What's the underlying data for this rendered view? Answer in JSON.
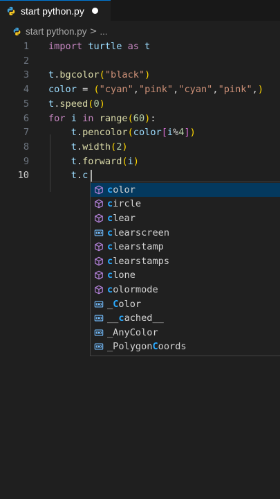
{
  "tab": {
    "label": "start python.py",
    "icon": "python-icon",
    "dirty_indicator": "modified-dot"
  },
  "breadcrumb": {
    "file": "start python.py",
    "separator": ">",
    "more": "..."
  },
  "editor": {
    "line_numbers": [
      "1",
      "2",
      "3",
      "4",
      "5",
      "6",
      "7",
      "8",
      "9",
      "10"
    ],
    "active_line": "10",
    "lines": [
      [
        {
          "t": "import",
          "c": "kw"
        },
        {
          "t": " ",
          "c": "pun"
        },
        {
          "t": "turtle",
          "c": "id"
        },
        {
          "t": " ",
          "c": "pun"
        },
        {
          "t": "as",
          "c": "kw"
        },
        {
          "t": " ",
          "c": "pun"
        },
        {
          "t": "t",
          "c": "id"
        }
      ],
      [],
      [
        {
          "t": "t",
          "c": "id"
        },
        {
          "t": ".",
          "c": "pun"
        },
        {
          "t": "bgcolor",
          "c": "fn"
        },
        {
          "t": "(",
          "c": "br1"
        },
        {
          "t": "\"black\"",
          "c": "str"
        },
        {
          "t": ")",
          "c": "br1"
        }
      ],
      [
        {
          "t": "color",
          "c": "id"
        },
        {
          "t": " = ",
          "c": "pun"
        },
        {
          "t": "(",
          "c": "br1"
        },
        {
          "t": "\"cyan\"",
          "c": "str"
        },
        {
          "t": ",",
          "c": "pun"
        },
        {
          "t": "\"pink\"",
          "c": "str"
        },
        {
          "t": ",",
          "c": "pun"
        },
        {
          "t": "\"cyan\"",
          "c": "str"
        },
        {
          "t": ",",
          "c": "pun"
        },
        {
          "t": "\"pink\"",
          "c": "str"
        },
        {
          "t": ",",
          "c": "pun"
        },
        {
          "t": ")",
          "c": "br1"
        }
      ],
      [
        {
          "t": "t",
          "c": "id"
        },
        {
          "t": ".",
          "c": "pun"
        },
        {
          "t": "speed",
          "c": "fn"
        },
        {
          "t": "(",
          "c": "br1"
        },
        {
          "t": "0",
          "c": "num"
        },
        {
          "t": ")",
          "c": "br1"
        }
      ],
      [
        {
          "t": "for",
          "c": "kw"
        },
        {
          "t": " ",
          "c": "pun"
        },
        {
          "t": "i",
          "c": "id"
        },
        {
          "t": " ",
          "c": "pun"
        },
        {
          "t": "in",
          "c": "kw"
        },
        {
          "t": " ",
          "c": "pun"
        },
        {
          "t": "range",
          "c": "fn"
        },
        {
          "t": "(",
          "c": "br1"
        },
        {
          "t": "60",
          "c": "num"
        },
        {
          "t": ")",
          "c": "br1"
        },
        {
          "t": ":",
          "c": "pun"
        }
      ],
      [
        {
          "t": "    ",
          "c": "pun"
        },
        {
          "t": "t",
          "c": "id"
        },
        {
          "t": ".",
          "c": "pun"
        },
        {
          "t": "pencolor",
          "c": "fn"
        },
        {
          "t": "(",
          "c": "br1"
        },
        {
          "t": "color",
          "c": "id"
        },
        {
          "t": "[",
          "c": "br2"
        },
        {
          "t": "i",
          "c": "id"
        },
        {
          "t": "%",
          "c": "pun"
        },
        {
          "t": "4",
          "c": "num"
        },
        {
          "t": "]",
          "c": "br2"
        },
        {
          "t": ")",
          "c": "br1"
        }
      ],
      [
        {
          "t": "    ",
          "c": "pun"
        },
        {
          "t": "t",
          "c": "id"
        },
        {
          "t": ".",
          "c": "pun"
        },
        {
          "t": "width",
          "c": "fn"
        },
        {
          "t": "(",
          "c": "br1"
        },
        {
          "t": "2",
          "c": "num"
        },
        {
          "t": ")",
          "c": "br1"
        }
      ],
      [
        {
          "t": "    ",
          "c": "pun"
        },
        {
          "t": "t",
          "c": "id"
        },
        {
          "t": ".",
          "c": "pun"
        },
        {
          "t": "forward",
          "c": "fn"
        },
        {
          "t": "(",
          "c": "br1"
        },
        {
          "t": "i",
          "c": "id"
        },
        {
          "t": ")",
          "c": "br1"
        }
      ],
      [
        {
          "t": "    ",
          "c": "pun"
        },
        {
          "t": "t",
          "c": "id"
        },
        {
          "t": ".",
          "c": "pun"
        },
        {
          "t": "c",
          "c": "id"
        }
      ]
    ]
  },
  "suggestions": {
    "typed_prefix": "c",
    "items": [
      {
        "before": "",
        "match": "c",
        "after": "olor",
        "icon": "cube-icon",
        "selected": true
      },
      {
        "before": "",
        "match": "c",
        "after": "ircle",
        "icon": "cube-icon"
      },
      {
        "before": "",
        "match": "c",
        "after": "lear",
        "icon": "cube-icon"
      },
      {
        "before": "",
        "match": "c",
        "after": "learscreen",
        "icon": "variable-icon"
      },
      {
        "before": "",
        "match": "c",
        "after": "learstamp",
        "icon": "cube-icon"
      },
      {
        "before": "",
        "match": "c",
        "after": "learstamps",
        "icon": "cube-icon"
      },
      {
        "before": "",
        "match": "c",
        "after": "lone",
        "icon": "cube-icon"
      },
      {
        "before": "",
        "match": "c",
        "after": "olormode",
        "icon": "cube-icon"
      },
      {
        "before": "_",
        "match": "C",
        "after": "olor",
        "icon": "variable-icon"
      },
      {
        "before": "__",
        "match": "c",
        "after": "ached__",
        "icon": "variable-icon"
      },
      {
        "before": "_AnyColor",
        "match": "",
        "after": "",
        "icon": "variable-icon"
      },
      {
        "before": "_Polygon",
        "match": "C",
        "after": "oords",
        "icon": "variable-icon"
      }
    ]
  },
  "colors": {
    "background": "#1f1f1f",
    "keyword": "#c586c0",
    "function": "#dcdcaa",
    "string": "#ce9178",
    "number": "#b5cea8",
    "variable": "#9cdcfe",
    "match_highlight": "#2aaaff",
    "selected_row": "#04395e",
    "cube_icon": "#b180d7",
    "variable_icon": "#75beff"
  }
}
